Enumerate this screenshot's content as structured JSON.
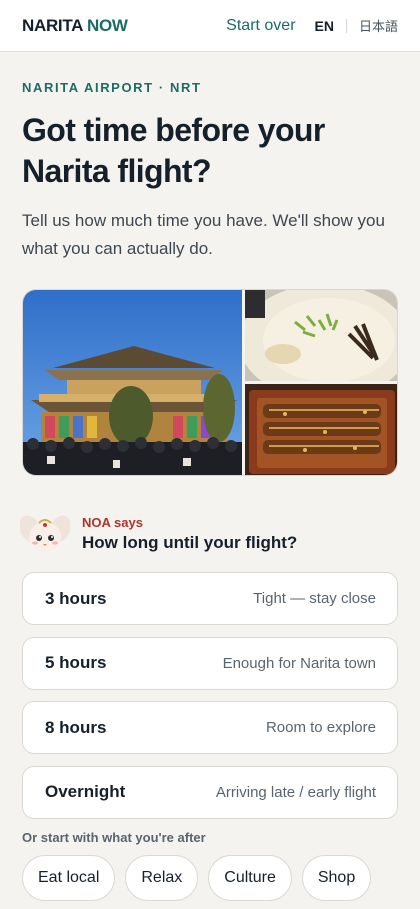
{
  "header": {
    "logo_brand": "NARITA",
    "logo_accent": "NOW",
    "start_over": "Start over",
    "lang_en": "EN",
    "lang_ja": "日本語"
  },
  "hero": {
    "eyebrow": "NARITA AIRPORT · NRT",
    "headline": "Got time before your Narita flight?",
    "subtext": "Tell us how much time you have. We'll show you what you can actually do."
  },
  "photos": [
    "temple-photo",
    "ramen-photo",
    "unagi-photo"
  ],
  "noa": {
    "says": "NOA says",
    "question": "How long until your flight?"
  },
  "options": [
    {
      "label": "3 hours",
      "hint": "Tight — stay close"
    },
    {
      "label": "5 hours",
      "hint": "Enough for Narita town"
    },
    {
      "label": "8 hours",
      "hint": "Room to explore"
    },
    {
      "label": "Overnight",
      "hint": "Arriving late / early flight"
    }
  ],
  "chips_title": "Or start with what you're after",
  "chips": [
    "Eat local",
    "Relax",
    "Culture",
    "Shop"
  ],
  "colors": {
    "accent": "#1e6b63",
    "noa_red": "#b2322a",
    "background": "#f5f3ef"
  }
}
